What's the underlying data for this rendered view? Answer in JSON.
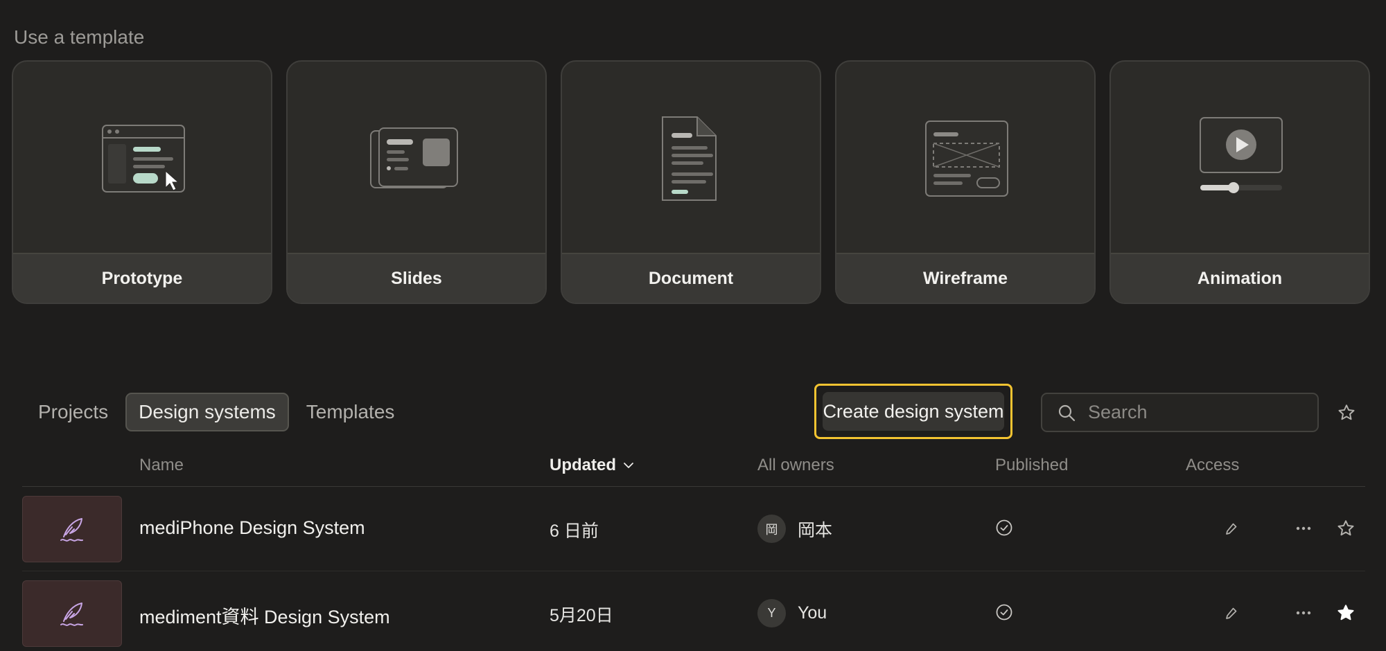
{
  "templates_section": {
    "title": "Use a template",
    "cards": [
      {
        "label": "Prototype"
      },
      {
        "label": "Slides"
      },
      {
        "label": "Document"
      },
      {
        "label": "Wireframe"
      },
      {
        "label": "Animation"
      }
    ]
  },
  "tabs": [
    {
      "label": "Projects",
      "active": false
    },
    {
      "label": "Design systems",
      "active": true
    },
    {
      "label": "Templates",
      "active": false
    }
  ],
  "toolbar": {
    "create_label": "Create design system",
    "search_placeholder": "Search"
  },
  "table": {
    "columns": {
      "name": "Name",
      "updated": "Updated",
      "owners": "All owners",
      "published": "Published",
      "access": "Access"
    },
    "rows": [
      {
        "name": "mediPhone Design System",
        "updated": "6 日前",
        "owner_initial": "岡",
        "owner_name": "岡本",
        "published": true,
        "starred": false
      },
      {
        "name": "mediment資料 Design System",
        "updated": "5月20日",
        "owner_initial": "Y",
        "owner_name": "You",
        "published": true,
        "starred": true
      }
    ]
  },
  "colors": {
    "background": "#1e1d1c",
    "highlight": "#f4c431",
    "thumbnail_bg": "#3b2a2a",
    "thumbnail_icon": "#c9a6e6"
  }
}
